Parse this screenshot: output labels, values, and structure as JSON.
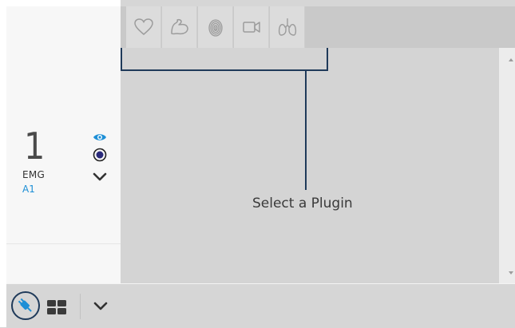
{
  "channel": {
    "number": "1",
    "type": "EMG",
    "id": "A1"
  },
  "main": {
    "placeholder": "Select a Plugin"
  },
  "plugin_tabs": [
    {
      "icon": "heart-icon"
    },
    {
      "icon": "arm-muscle-icon"
    },
    {
      "icon": "fingerprint-icon"
    },
    {
      "icon": "video-camera-icon"
    },
    {
      "icon": "lungs-icon"
    }
  ],
  "channel_controls": [
    {
      "icon": "eye-icon"
    },
    {
      "icon": "record-radio-icon"
    },
    {
      "icon": "chevron-down-icon"
    }
  ],
  "bottom_bar": [
    {
      "icon": "plug-icon"
    },
    {
      "icon": "grid-icon"
    },
    {
      "icon": "chevron-down-icon"
    }
  ],
  "colors": {
    "accent": "#1d8fd6",
    "text": "#3a3a3a",
    "connector": "#1f3a5a",
    "background": "#d6d6d6"
  }
}
